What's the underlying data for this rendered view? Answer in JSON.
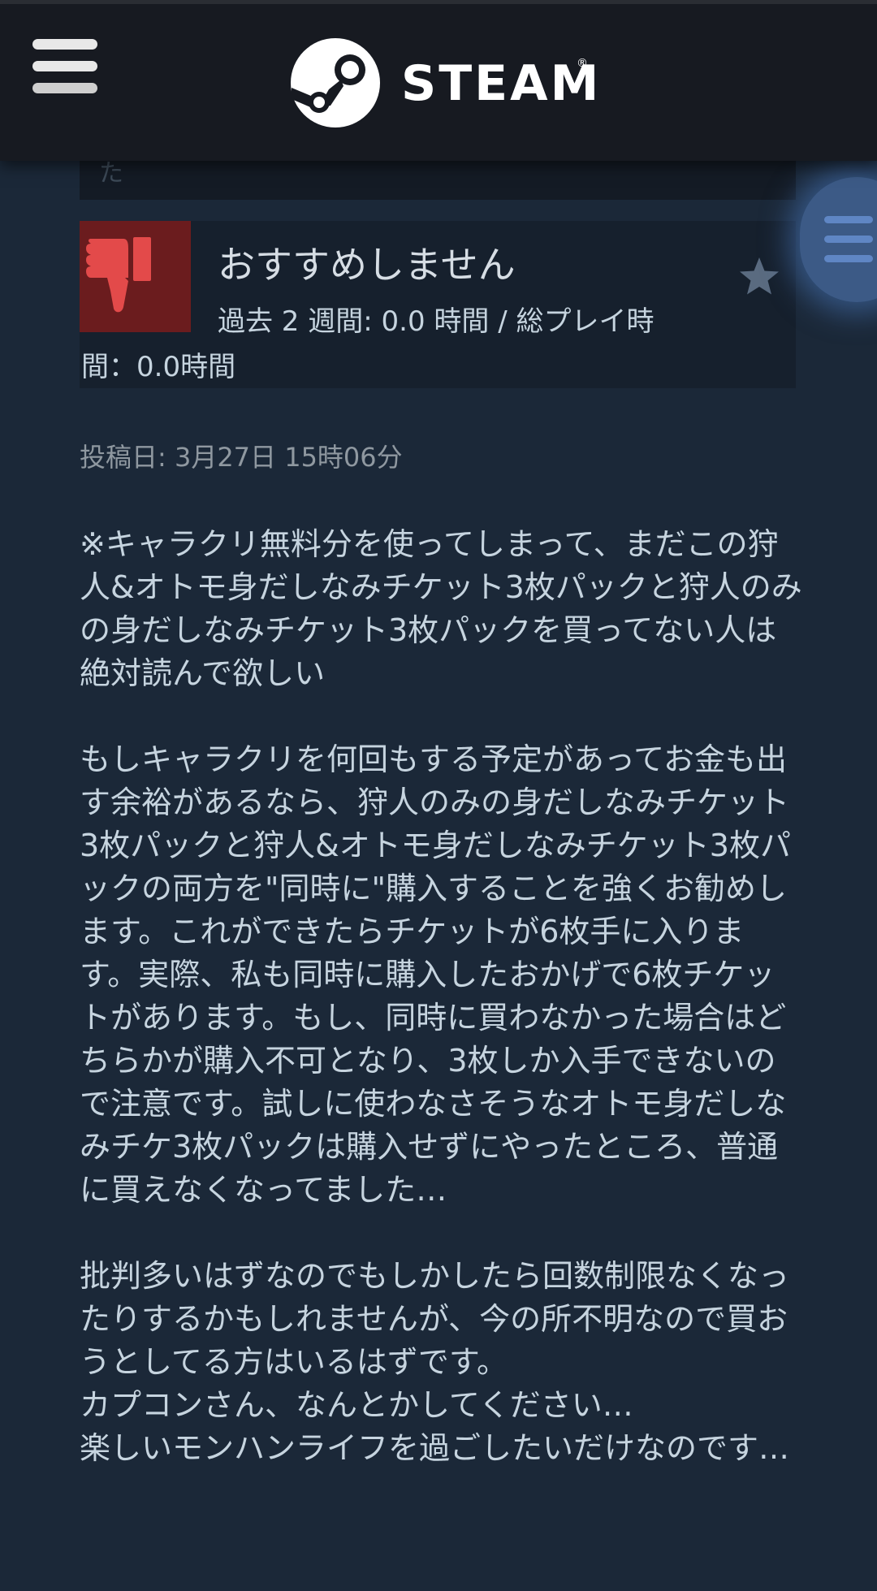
{
  "header": {
    "brand": "STEAM",
    "registered_mark": "®"
  },
  "previous_review": {
    "overflow_text": "た"
  },
  "review": {
    "verdict": "おすすめしません",
    "hours_line1": "過去 2 週間: 0.0 時間 / 総プレイ時",
    "hours_line2": "間：0.0時間",
    "posted": "投稿日: 3月27日 15時06分",
    "paragraphs": [
      "※キャラクリ無料分を使ってしまって、まだこの狩人&オトモ身だしなみチケット3枚パックと狩人のみの身だしなみチケット3枚パックを買ってない人は絶対読んで欲しい",
      "もしキャラクリを何回もする予定があってお金も出す余裕があるなら、狩人のみの身だしなみチケット3枚パックと狩人&オトモ身だしなみチケット3枚パックの両方を\"同時に\"購入することを強くお勧めします。これができたらチケットが6枚手に入ります。実際、私も同時に購入したおかげで6枚チケットがあります。もし、同時に買わなかった場合はどちらかが購入不可となり、3枚しか入手できないので注意です。試しに使わなさそうなオトモ身だしなみチケ3枚パックは購入せずにやったところ、普通に買えなくなってました…",
      "批判多いはずなのでもしかしたら回数制限なくなったりするかもしれませんが、今の所不明なので買おうとしてる方はいるはずです。\nカプコンさん、なんとかしてください…\n楽しいモンハンライフを過ごしたいだけなのです…"
    ]
  },
  "icons": {
    "menu": "hamburger-menu-icon",
    "logo": "steam-logo-icon",
    "thumb": "thumbs-down-icon",
    "award": "award-star-icon",
    "side": "side-menu-icon"
  },
  "colors": {
    "header_bg": "#171a21",
    "page_bg": "#1b2838",
    "thumb_bg": "#6b1c1e",
    "thumb_icon": "#e34a4a",
    "posted_text": "#8f98a0"
  }
}
